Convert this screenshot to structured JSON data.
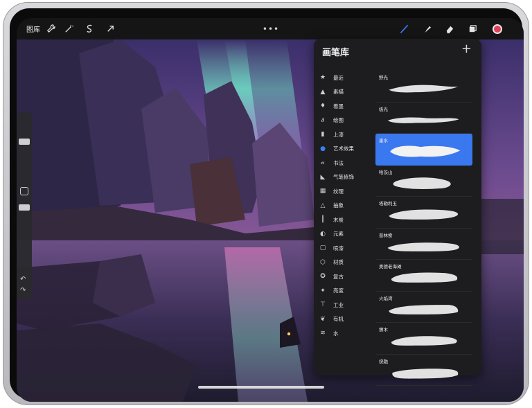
{
  "topbar": {
    "gallery_label": "图库",
    "tools": [
      {
        "name": "wrench-icon",
        "glyph": "actions"
      },
      {
        "name": "magic-wand-icon",
        "glyph": "adjustments"
      },
      {
        "name": "selection-icon",
        "glyph": "selection"
      },
      {
        "name": "arrow-cursor-icon",
        "glyph": "transform"
      }
    ],
    "right_tools": [
      "brush-icon",
      "smudge-icon",
      "eraser-icon",
      "layers-icon"
    ],
    "active_tool": "brush-icon",
    "color": "#e0405a"
  },
  "panel": {
    "title": "画笔库",
    "add_label": "+",
    "categories": [
      {
        "label": "最近",
        "icon": "star-icon"
      },
      {
        "label": "素描",
        "icon": "pencil-tip-icon"
      },
      {
        "label": "着墨",
        "icon": "ink-drop-icon"
      },
      {
        "label": "绘图",
        "icon": "swirl-icon"
      },
      {
        "label": "上漆",
        "icon": "paint-roller-icon"
      },
      {
        "label": "艺术效果",
        "icon": "palette-icon",
        "active": true
      },
      {
        "label": "书法",
        "icon": "calligraphy-icon"
      },
      {
        "label": "气笔修饰",
        "icon": "airbrush-icon"
      },
      {
        "label": "纹理",
        "icon": "texture-icon"
      },
      {
        "label": "抽象",
        "icon": "triangle-icon"
      },
      {
        "label": "木炭",
        "icon": "charcoal-icon"
      },
      {
        "label": "元素",
        "icon": "yin-yang-icon"
      },
      {
        "label": "喷漆",
        "icon": "spray-can-icon"
      },
      {
        "label": "材质",
        "icon": "cube-icon"
      },
      {
        "label": "复古",
        "icon": "retro-star-icon"
      },
      {
        "label": "亮度",
        "icon": "sparkle-icon"
      },
      {
        "label": "工业",
        "icon": "anvil-icon"
      },
      {
        "label": "有机",
        "icon": "leaf-icon"
      },
      {
        "label": "水",
        "icon": "waves-icon"
      }
    ],
    "brushes": [
      {
        "label": "野光",
        "selected": false
      },
      {
        "label": "极光",
        "selected": false
      },
      {
        "label": "墨水",
        "selected": true
      },
      {
        "label": "哈茨山",
        "selected": false
      },
      {
        "label": "塔勒利玉",
        "selected": false
      },
      {
        "label": "普林索",
        "selected": false
      },
      {
        "label": "奥德老海滩",
        "selected": false
      },
      {
        "label": "火焰湾",
        "selected": false
      },
      {
        "label": "擦木",
        "selected": false
      },
      {
        "label": "烧融",
        "selected": false
      }
    ]
  },
  "colors": {
    "accent": "#3a78ef",
    "panel_bg": "#1d1d1f",
    "topbar_bg": "#151516"
  }
}
